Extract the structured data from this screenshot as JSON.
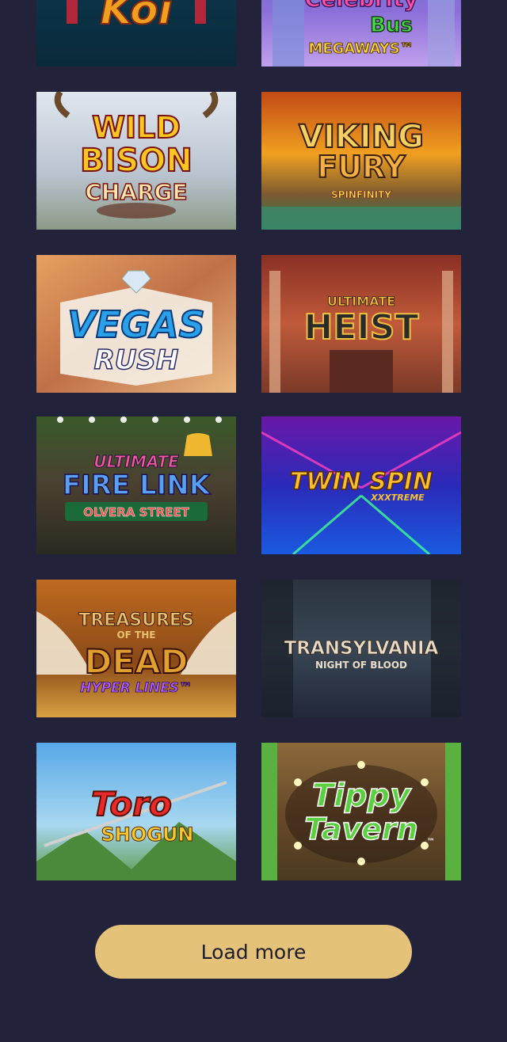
{
  "games": [
    {
      "title": "Koi"
    },
    {
      "title_line1": "Celebrity",
      "title_line2": "Bus",
      "subtitle": "MEGAWAYS™"
    },
    {
      "title_line1": "WILD",
      "title_line2": "BISON",
      "title_line3": "CHARGE"
    },
    {
      "title_line1": "VIKING",
      "title_line2": "FURY",
      "subtitle": "SPINFINITY"
    },
    {
      "title_line1": "VEGAS",
      "title_line2": "RUSH"
    },
    {
      "title_line1": "ULTIMATE",
      "title_line2": "HEIST"
    },
    {
      "title_line1": "ULTIMATE",
      "title_line2": "FIRE LINK",
      "subtitle": "OLVERA STREET"
    },
    {
      "title_line1": "TWIN SPIN",
      "subtitle": "XXXTREME"
    },
    {
      "title_line1": "TREASURES",
      "title_line2": "OF THE",
      "title_line3": "DEAD",
      "subtitle": "HYPER LINES™"
    },
    {
      "title_line1": "TRANSYLVANIA",
      "subtitle": "NIGHT OF BLOOD"
    },
    {
      "title_line1": "Toro",
      "title_line2": "SHOGUN"
    },
    {
      "title_line1": "Tippy",
      "title_line2": "Tavern",
      "tm": "™"
    }
  ],
  "load_more": {
    "label": "Load more"
  },
  "colors": {
    "background": "#23223b",
    "button": "#e5c27a",
    "button_text": "#1e1d30"
  }
}
